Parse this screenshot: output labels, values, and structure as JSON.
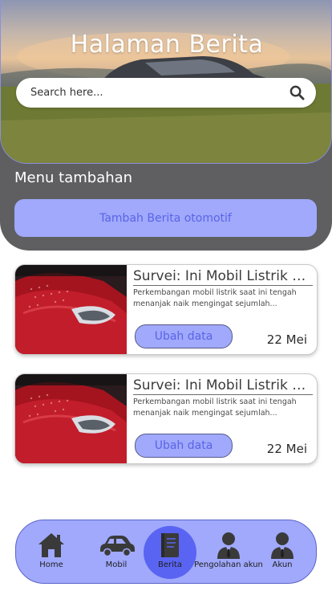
{
  "header": {
    "title": "Halaman Berita",
    "search_placeholder": "Search here..."
  },
  "menu": {
    "heading": "Menu tambahan",
    "add_button_label": "Tambah Berita otomotif"
  },
  "news": [
    {
      "title": "Survei: Ini Mobil Listrik Pali",
      "excerpt": "Perkembangan mobil listrik saat ini tengah menanjak naik mengingat sejumlah...",
      "edit_label": "Ubah data",
      "date": "22 Mei"
    },
    {
      "title": "Survei: Ini Mobil Listrik Pali",
      "excerpt": "Perkembangan mobil listrik saat ini tengah menanjak naik mengingat sejumlah...",
      "edit_label": "Ubah data",
      "date": "22 Mei"
    }
  ],
  "nav": {
    "items": [
      {
        "label": "Home",
        "icon": "home-icon"
      },
      {
        "label": "Mobil",
        "icon": "car-icon"
      },
      {
        "label": "Berita",
        "icon": "news-icon",
        "active": true
      },
      {
        "label": "Pengolahan akun",
        "icon": "user-manager-icon"
      },
      {
        "label": "Akun",
        "icon": "account-icon"
      }
    ]
  },
  "colors": {
    "accent": "#a0a9fb",
    "accent_text": "#5a64e6",
    "active_nav": "#5a64f2",
    "panel": "#5f5f62"
  }
}
